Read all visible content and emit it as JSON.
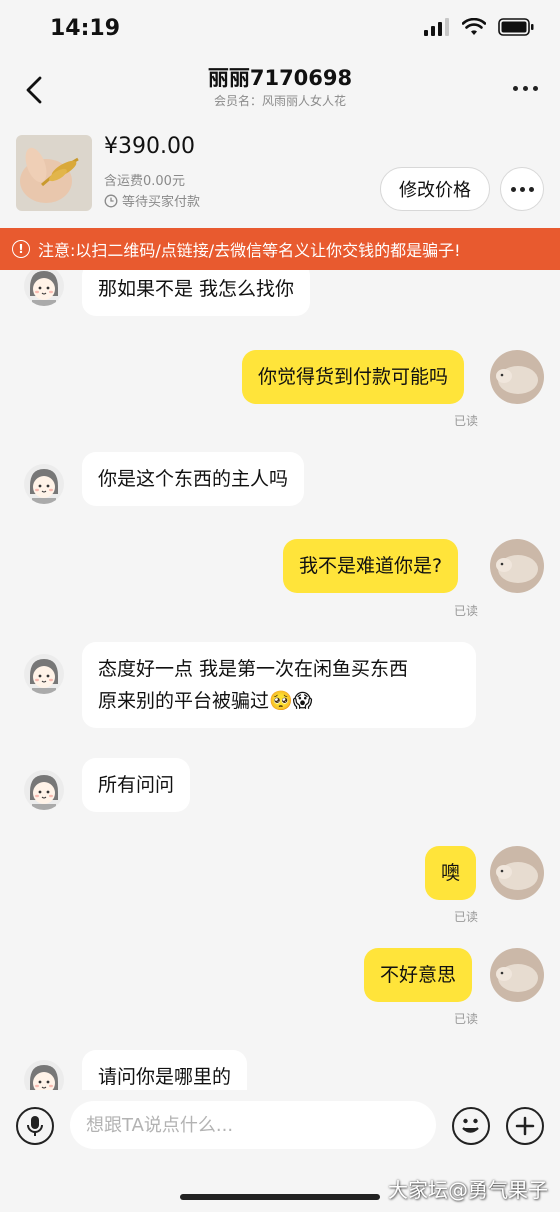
{
  "status_bar": {
    "time": "14:19"
  },
  "header": {
    "title": "丽丽7170698",
    "subtitle": "会员名：风雨丽人女人花"
  },
  "product": {
    "price": "¥390.00",
    "shipping": "含运费0.00元",
    "status": "等待买家付款",
    "edit_price_label": "修改价格"
  },
  "warning": {
    "text": "注意:以扫二维码/点链接/去微信等名义让你交钱的都是骗子!"
  },
  "messages": [
    {
      "dir": "in",
      "text": "那如果不是 我怎么找你"
    },
    {
      "dir": "out",
      "text": "你觉得货到付款可能吗",
      "status": "已读"
    },
    {
      "dir": "in",
      "text": "你是这个东西的主人吗"
    },
    {
      "dir": "out",
      "text": "我不是难道你是?",
      "status": "已读"
    },
    {
      "dir": "in",
      "text": "态度好一点  我是第一次在闲鱼买东西",
      "text2": "原来别的平台被骗过",
      "emojis": "🥺😱"
    },
    {
      "dir": "in",
      "text": "所有问问"
    },
    {
      "dir": "out",
      "text": "噢",
      "status": "已读"
    },
    {
      "dir": "out",
      "text": "不好意思",
      "status": "已读"
    },
    {
      "dir": "in",
      "text": "请问你是哪里的"
    }
  ],
  "input": {
    "placeholder": "想跟TA说点什么..."
  },
  "watermark": "大家坛@勇气果子",
  "colors": {
    "accent": "#ffe43a",
    "warning": "#e85a2f",
    "background": "#f5f5f5"
  },
  "icons": [
    "back-icon",
    "more-icon",
    "clock-icon",
    "warning-icon",
    "mic-icon",
    "emoji-icon",
    "plus-icon"
  ]
}
